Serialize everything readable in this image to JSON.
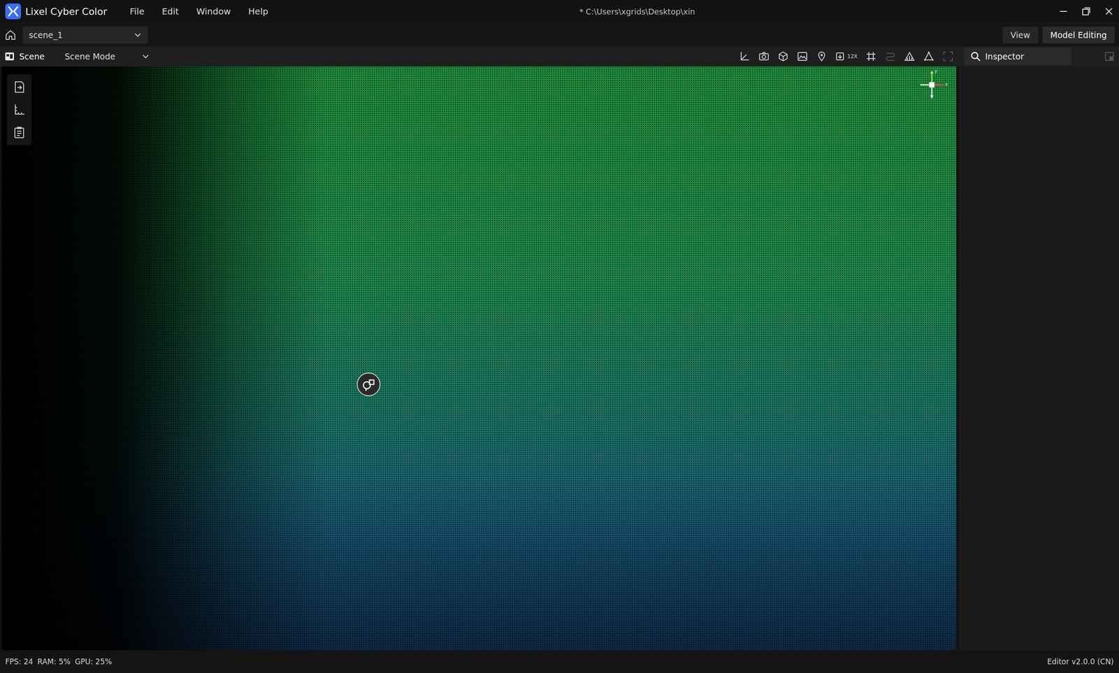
{
  "window": {
    "title": "Lixel Cyber Color",
    "path": "* C:\\Users\\xgrids\\Desktop\\xin"
  },
  "menu": [
    "File",
    "Edit",
    "Window",
    "Help"
  ],
  "scene_selector": {
    "value": "scene_1"
  },
  "mode_buttons": [
    {
      "label": "View",
      "selected": false
    },
    {
      "label": "Model Editing",
      "selected": true
    }
  ],
  "scene_panel": {
    "title": "Scene",
    "mode": "Scene Mode"
  },
  "toolbar_badge": "12X",
  "gizmo": {
    "y": "y",
    "x": "x"
  },
  "inspector": {
    "title": "Inspector"
  },
  "status_bar": {
    "stats": [
      "FPS: 24",
      "RAM: 5%",
      "GPU: 25%"
    ],
    "version": "Editor v2.0.0 (CN)"
  }
}
